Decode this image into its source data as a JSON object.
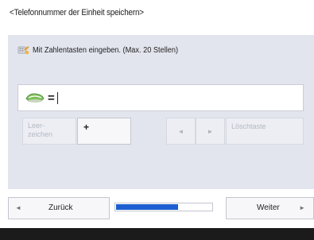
{
  "title": "<Telefonnummer der Einheit speichern>",
  "instruction": {
    "icon": "keypad-hand-icon",
    "text": "Mit Zahlentasten eingeben. (Max. 20 Stellen)"
  },
  "input": {
    "icon": "phone-handset-icon",
    "prefix": "=",
    "value": ""
  },
  "keys": {
    "space_label": "Leer-zeichen",
    "plus_label": "+",
    "left_arrow": "◄",
    "right_arrow": "►",
    "delete_label": "Löschtaste"
  },
  "nav": {
    "back_label": "Zurück",
    "back_arrow": "◄",
    "next_label": "Weiter",
    "next_arrow": "►"
  },
  "progress": {
    "fraction": 0.65
  },
  "colors": {
    "panel": "#e3e5ee",
    "progress_fill": "#1d5fd0",
    "footer": "#1b1b1b"
  }
}
